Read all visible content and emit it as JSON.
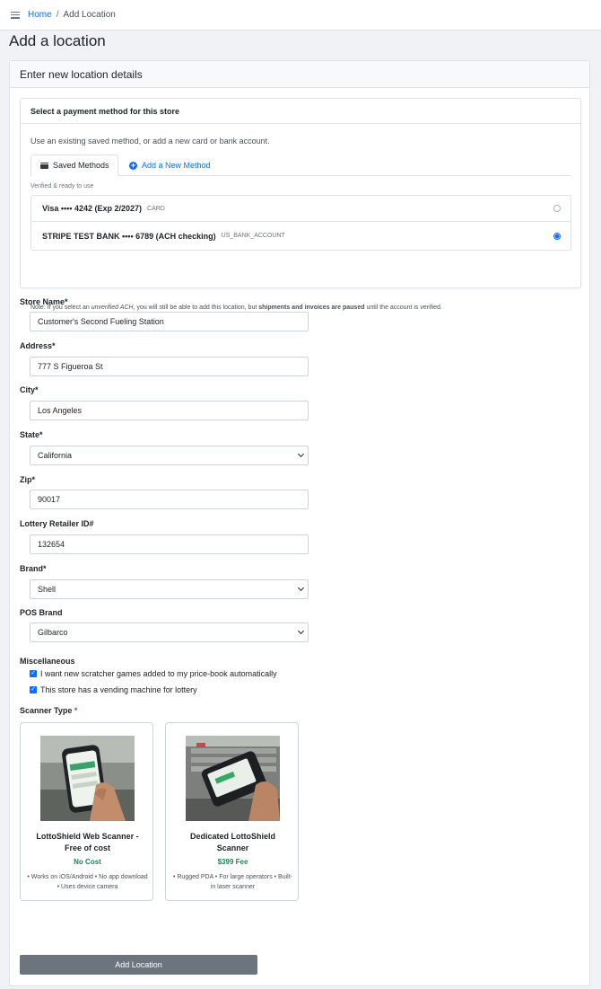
{
  "breadcrumb": {
    "home": "Home",
    "separator": "/",
    "current": "Add Location"
  },
  "page_title": "Add a location",
  "card_title": "Enter new location details",
  "payment": {
    "title": "Select a payment method for this store",
    "description": "Use an existing saved method, or add a new card or bank account.",
    "tabs": {
      "saved": "Saved Methods",
      "add": "Add a New Method"
    },
    "verified_label": "Verified & ready to use",
    "methods": [
      {
        "name": "Visa •••• 4242 (Exp 2/2027)",
        "type": "CARD",
        "selected": false
      },
      {
        "name": "STRIPE TEST BANK •••• 6789 (ACH checking)",
        "type": "US_BANK_ACCOUNT",
        "selected": true
      }
    ],
    "note": {
      "prefix": "Note: If you select an ",
      "emph": "unverified ACH",
      "middle": ", you will still be able to add this location, but ",
      "strong": "shipments and invoices are paused",
      "suffix": " until the account is verified."
    }
  },
  "form": {
    "store_name": {
      "label": "Store Name*",
      "value": "Customer's Second Fueling Station"
    },
    "address": {
      "label": "Address*",
      "value": "777 S Figueroa St"
    },
    "city": {
      "label": "City*",
      "value": "Los Angeles"
    },
    "state": {
      "label": "State*",
      "value": "California"
    },
    "zip": {
      "label": "Zip*",
      "value": "90017"
    },
    "lottery_id": {
      "label": "Lottery Retailer ID#",
      "value": "132654"
    },
    "brand": {
      "label": "Brand*",
      "value": "Shell"
    },
    "pos_brand": {
      "label": "POS Brand",
      "value": "Gilbarco"
    },
    "misc": {
      "label": "Miscellaneous",
      "options": [
        "I want new scratcher games added to my price-book automatically",
        "This store has a vending machine for lottery"
      ]
    },
    "scanner": {
      "label": "Scanner Type",
      "required_mark": "*",
      "options": [
        {
          "title": "LottoShield Web Scanner - Free of cost",
          "price": "No Cost",
          "desc": "• Works on iOS/Android • No app download • Uses device camera"
        },
        {
          "title": "Dedicated LottoShield Scanner",
          "price": "$399 Fee",
          "desc": "• Rugged PDA • For large operators • Built-in laser scanner"
        }
      ]
    },
    "submit_label": "Add Location"
  },
  "colors": {
    "primary": "#0d6efd",
    "success": "#198754",
    "button": "#6c757d",
    "danger": "#dc3545"
  },
  "icons": [
    "menu-icon",
    "wallet-icon",
    "plus-circle-icon",
    "chevron-down-icon",
    "check-icon"
  ]
}
